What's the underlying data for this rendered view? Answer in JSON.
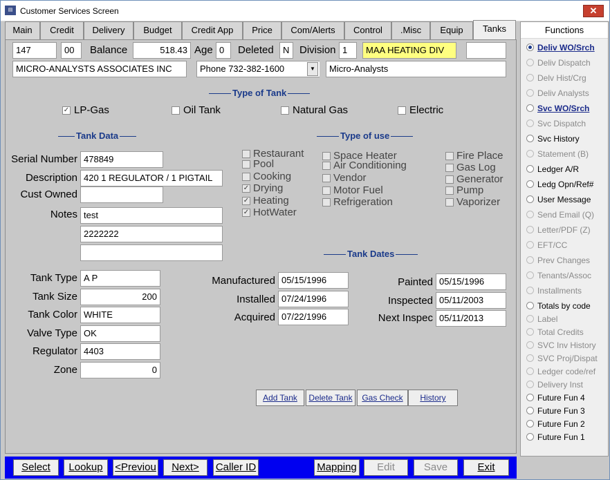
{
  "window": {
    "title": "Customer Services Screen",
    "app_icon": "app-icon",
    "close_icon": "close-icon"
  },
  "tabs": [
    "Main",
    "Credit",
    "Delivery",
    "Budget",
    "Credit App",
    "Price",
    "Com/Alerts",
    "Control",
    ".Misc",
    "Equip",
    "Tanks"
  ],
  "header": {
    "account": "147",
    "sub": "00",
    "balance_label": "Balance",
    "balance": "518.43",
    "age_label": "Age",
    "age": "0",
    "deleted_label": "Deleted",
    "deleted": "N",
    "division_label": "Division",
    "division": "1",
    "division_name": "MAA HEATING  DIV",
    "extra": "",
    "company": "MICRO-ANALYSTS ASSOCIATES INC",
    "phone": "Phone 732-382-1600",
    "short_name": "Micro-Analysts"
  },
  "type_of_tank": {
    "title": "Type of Tank",
    "options": [
      {
        "label": "LP-Gas",
        "checked": true
      },
      {
        "label": "Oil Tank",
        "checked": false
      },
      {
        "label": "Natural Gas",
        "checked": false
      },
      {
        "label": "Electric",
        "checked": false
      }
    ]
  },
  "tank_data": {
    "title": "Tank Data",
    "serial_label": "Serial Number",
    "serial": "478849",
    "description_label": "Description",
    "description": "420  1 REGULATOR  / 1 PIGTAIL",
    "cust_owned_label": "Cust Owned",
    "cust_owned": "",
    "notes_label": "Notes",
    "notes": [
      "test",
      "2222222",
      ""
    ],
    "tank_type_label": "Tank Type",
    "tank_type": "A P",
    "tank_size_label": "Tank Size",
    "tank_size": "200",
    "tank_color_label": "Tank Color",
    "tank_color": "WHITE",
    "valve_type_label": "Valve Type",
    "valve_type": "OK",
    "regulator_label": "Regulator",
    "regulator": "4403",
    "zone_label": "Zone",
    "zone": "0"
  },
  "type_of_use": {
    "title": "Type of use",
    "col1": [
      {
        "label": "Restaurant",
        "checked": false
      },
      {
        "label": "Pool",
        "checked": false
      },
      {
        "label": "Cooking",
        "checked": false
      },
      {
        "label": "Drying",
        "checked": true
      },
      {
        "label": "Heating",
        "checked": true
      },
      {
        "label": "HotWater",
        "checked": true
      }
    ],
    "col2": [
      {
        "label": "Space Heater",
        "checked": false
      },
      {
        "label": "Air Conditioning",
        "checked": false
      },
      {
        "label": "Vendor",
        "checked": false
      },
      {
        "label": "Motor Fuel",
        "checked": false
      },
      {
        "label": "Refrigeration",
        "checked": false
      }
    ],
    "col3": [
      {
        "label": "Fire Place",
        "checked": false
      },
      {
        "label": "Gas Log",
        "checked": false
      },
      {
        "label": "Generator",
        "checked": false
      },
      {
        "label": "Pump",
        "checked": false
      },
      {
        "label": "Vaporizer",
        "checked": false
      }
    ]
  },
  "tank_dates": {
    "title": "Tank Dates",
    "manufactured_label": "Manufactured",
    "manufactured": "05/15/1996",
    "installed_label": "Installed",
    "installed": "07/24/1996",
    "acquired_label": "Acquired",
    "acquired": "07/22/1996",
    "painted_label": "Painted",
    "painted": "05/15/1996",
    "inspected_label": "Inspected",
    "inspected": "05/11/2003",
    "next_inspec_label": "Next Inspec",
    "next_inspec": "05/11/2013"
  },
  "actions": [
    "Add Tank",
    "Delete Tank",
    "Gas Check",
    "History"
  ],
  "functions": {
    "title": "Functions",
    "items": [
      {
        "label": "Deliv WO/Srch",
        "state": "selected"
      },
      {
        "label": "Deliv Dispatch",
        "state": "disabled"
      },
      {
        "label": "Delv Hist/Crg",
        "state": "disabled"
      },
      {
        "label": "Deliv Analysts",
        "state": "disabled"
      },
      {
        "label": "Svc WO/Srch",
        "state": "bold"
      },
      {
        "label": "Svc Dispatch",
        "state": "disabled"
      },
      {
        "label": "Svc History",
        "state": "normal"
      },
      {
        "label": "Statement (B)",
        "state": "disabled"
      },
      {
        "label": "Ledger A/R",
        "state": "normal"
      },
      {
        "label": "Ledg Opn/Ref#",
        "state": "normal"
      },
      {
        "label": "User Message",
        "state": "normal"
      },
      {
        "label": "Send Email (Q)",
        "state": "disabled"
      },
      {
        "label": "Letter/PDF (Z)",
        "state": "disabled"
      },
      {
        "label": "EFT/CC",
        "state": "disabled"
      },
      {
        "label": "Prev Changes",
        "state": "disabled"
      },
      {
        "label": "Tenants/Assoc",
        "state": "disabled"
      },
      {
        "label": "Installments",
        "state": "disabled"
      },
      {
        "label": "Totals by code",
        "state": "normal"
      },
      {
        "label": "Label",
        "state": "disabled"
      },
      {
        "label": "Total Credits",
        "state": "disabled"
      },
      {
        "label": "SVC Inv History",
        "state": "disabled"
      },
      {
        "label": "SVC Proj/Dispat",
        "state": "disabled"
      },
      {
        "label": "Ledger code/ref",
        "state": "disabled"
      },
      {
        "label": "Delivery Inst",
        "state": "disabled"
      },
      {
        "label": "Future Fun 4",
        "state": "normal"
      },
      {
        "label": "Future Fun 3",
        "state": "normal"
      },
      {
        "label": "Future Fun 2",
        "state": "normal"
      },
      {
        "label": "Future Fun 1",
        "state": "normal"
      }
    ]
  },
  "bottom": {
    "select": "Select",
    "lookup": "Lookup",
    "previous": "<Previou",
    "next": "Next>",
    "caller_id": "Caller ID",
    "mapping": "Mapping",
    "edit": "Edit",
    "save": "Save",
    "exit": "Exit"
  }
}
